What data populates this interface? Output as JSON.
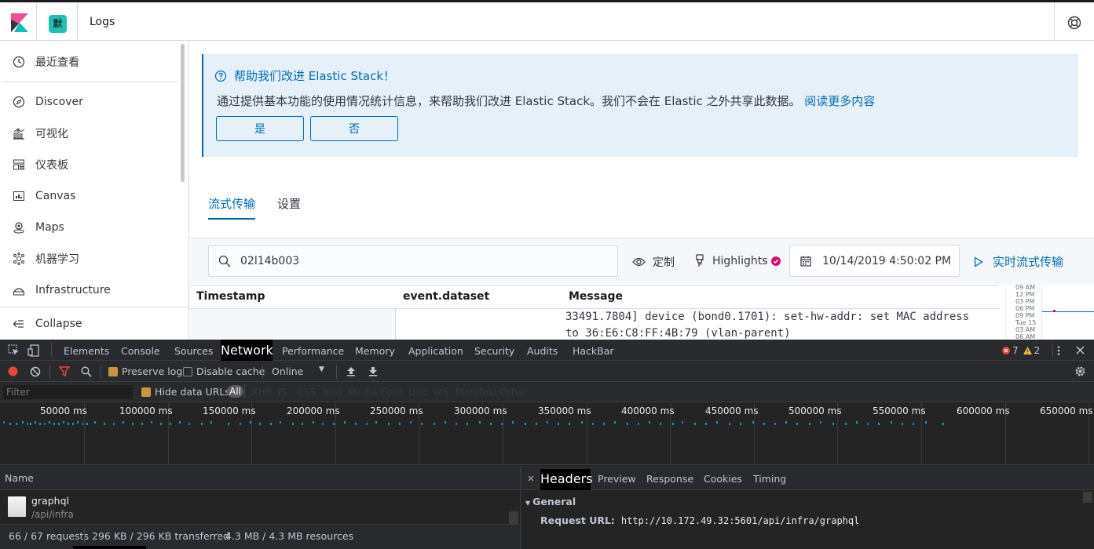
{
  "header": {
    "space_initial": "默",
    "app_title": "Logs"
  },
  "sidebar": {
    "recent": "最近查看",
    "items": [
      "Discover",
      "可视化",
      "仪表板",
      "Canvas",
      "Maps",
      "机器学习",
      "Infrastructure"
    ],
    "collapse": "Collapse"
  },
  "callout": {
    "title": "帮助我们改进 Elastic Stack！",
    "body": "通过提供基本功能的使用情况统计信息，来帮助我们改进 Elastic Stack。我们不会在 Elastic 之外共享此数据。",
    "link": "阅读更多内容",
    "yes": "是",
    "no": "否"
  },
  "tabs": {
    "stream": "流式传输",
    "settings": "设置"
  },
  "toolbar": {
    "search_value": "02l14b003",
    "customize": "定制",
    "highlights": "Highlights",
    "date": "10/14/2019 4:50:02 PM",
    "stream_live": "实时流式传输"
  },
  "table": {
    "col_timestamp": "Timestamp",
    "col_dataset": "event.dataset",
    "col_message": "Message",
    "message_line1": "33491.7804] device (bond0.1701): set-hw-addr: set MAC address",
    "message_line2": "to 36:E6:C8:FF:4B:79 (vlan-parent)"
  },
  "minimap": {
    "labels": [
      "09 AM",
      "12 PM",
      "03 PM",
      "06 PM",
      "09 PM",
      "Tue 15",
      "03 AM",
      "06 AM"
    ]
  },
  "devtools": {
    "tabs": [
      "Elements",
      "Console",
      "Sources",
      "Network",
      "Performance",
      "Memory",
      "Application",
      "Security",
      "Audits",
      "HackBar"
    ],
    "errors": "7",
    "warnings": "2",
    "preserve_log": "Preserve log",
    "disable_cache": "Disable cache",
    "throttle": "Online",
    "filter_placeholder": "Filter",
    "hide_data_urls": "Hide data URLs",
    "types": [
      "All",
      "XHR",
      "JS",
      "CSS",
      "Img",
      "Media",
      "Font",
      "Doc",
      "WS",
      "Manifest",
      "Other"
    ],
    "timeline_labels": [
      "50000 ms",
      "100000 ms",
      "150000 ms",
      "200000 ms",
      "250000 ms",
      "300000 ms",
      "350000 ms",
      "400000 ms",
      "450000 ms",
      "500000 ms",
      "550000 ms",
      "600000 ms",
      "650000 ms"
    ],
    "name_header": "Name",
    "request_name": "graphql",
    "request_path": "/api/infra",
    "status_requests": "66 / 67 requests",
    "status_transferred": "296 KB / 296 KB transferred",
    "status_resources": "4.3 MB / 4.3 MB resources",
    "detail_tabs": [
      "Headers",
      "Preview",
      "Response",
      "Cookies",
      "Timing"
    ],
    "general": "General",
    "request_url_label": "Request URL:",
    "request_url": "http://10.172.49.32:5601/api/infra/graphql"
  },
  "colors": {
    "accent": "#006bb4",
    "callout_bg": "#e6f0f8",
    "devtools_bg": "#242424",
    "error": "#e8453c",
    "warning": "#f2c037"
  }
}
